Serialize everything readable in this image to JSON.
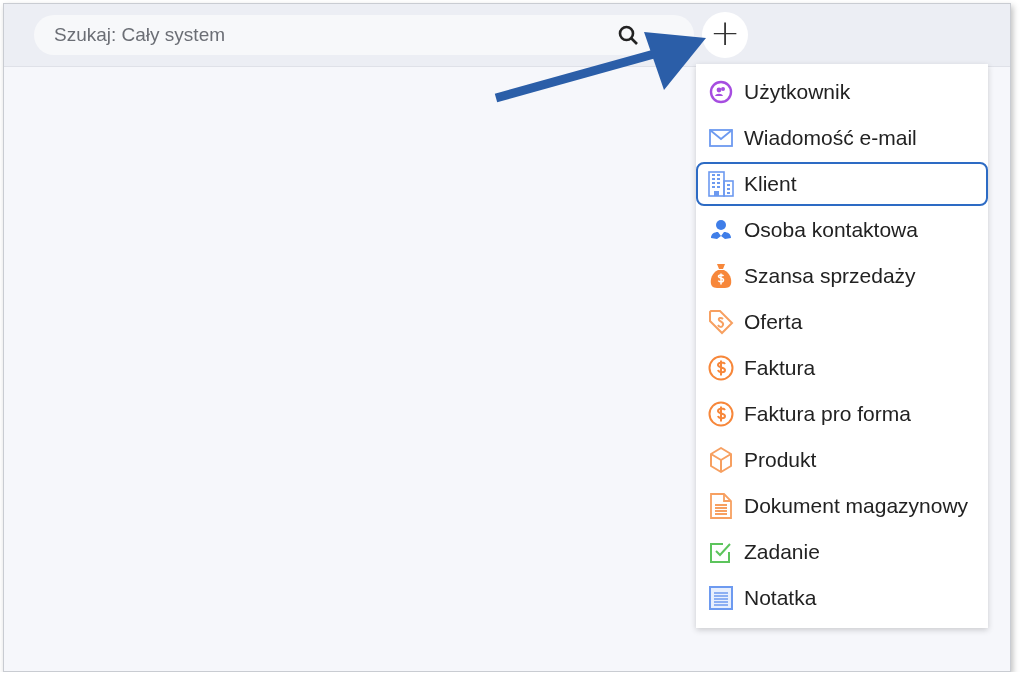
{
  "search": {
    "placeholder": "Szukaj: Cały system"
  },
  "add_button": {
    "label": "+"
  },
  "menu": {
    "items": [
      {
        "label": "Użytkownik",
        "kind": "user",
        "selected": false
      },
      {
        "label": "Wiadomość e-mail",
        "kind": "mail",
        "selected": false
      },
      {
        "label": "Klient",
        "kind": "building",
        "selected": true
      },
      {
        "label": "Osoba kontaktowa",
        "kind": "person",
        "selected": false
      },
      {
        "label": "Szansa sprzedaży",
        "kind": "moneybag",
        "selected": false
      },
      {
        "label": "Oferta",
        "kind": "tag",
        "selected": false
      },
      {
        "label": "Faktura",
        "kind": "dollar",
        "selected": false
      },
      {
        "label": "Faktura pro forma",
        "kind": "dollar",
        "selected": false
      },
      {
        "label": "Produkt",
        "kind": "box",
        "selected": false
      },
      {
        "label": "Dokument magazynowy",
        "kind": "document",
        "selected": false
      },
      {
        "label": "Zadanie",
        "kind": "check",
        "selected": false
      },
      {
        "label": "Notatka",
        "kind": "note",
        "selected": false
      }
    ]
  }
}
